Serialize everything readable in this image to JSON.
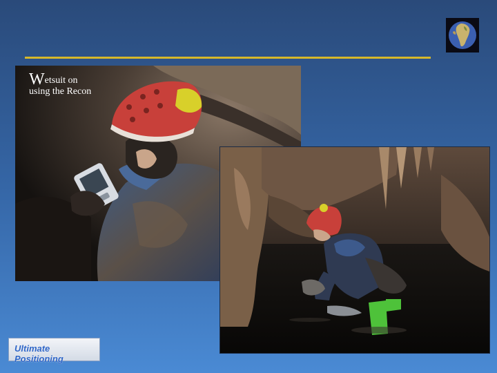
{
  "slide": {
    "caption_initial": "W",
    "caption_line1_rest": "etsuit on",
    "caption_line2": "using the Recon",
    "logo_text": "Ultimate Positioning",
    "accent_color": "#d6b82a"
  },
  "icons": [
    "globe-icon"
  ]
}
